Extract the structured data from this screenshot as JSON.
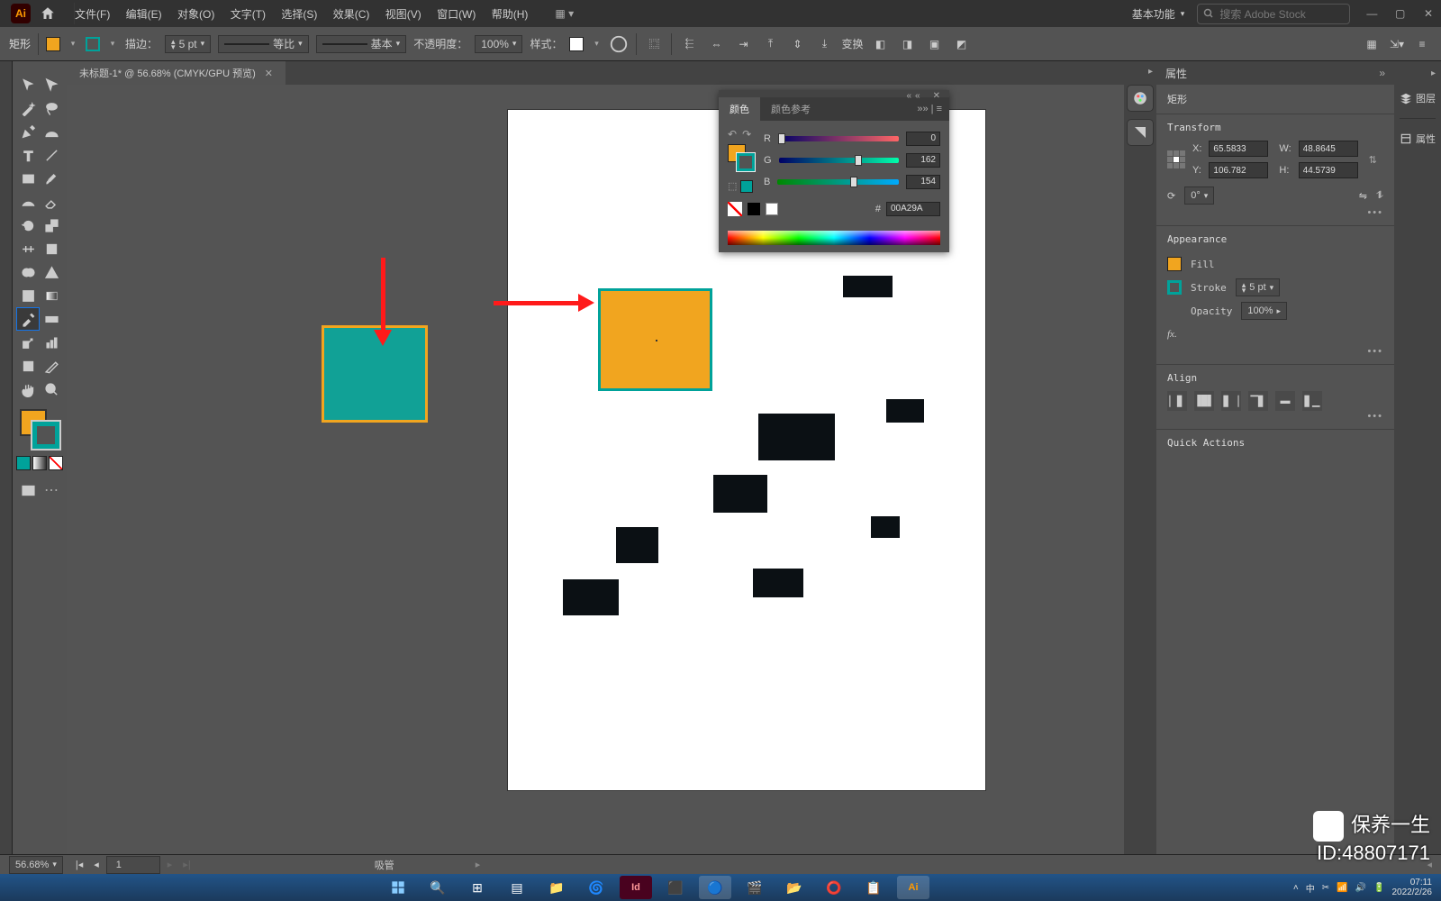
{
  "app": {
    "logo_text": "Ai"
  },
  "menus": {
    "file": "文件(F)",
    "edit": "编辑(E)",
    "object": "对象(O)",
    "type": "文字(T)",
    "select": "选择(S)",
    "effect": "效果(C)",
    "view": "视图(V)",
    "window": "窗口(W)",
    "help": "帮助(H)"
  },
  "workspace": {
    "label": "基本功能"
  },
  "search": {
    "placeholder": "搜索 Adobe Stock"
  },
  "control": {
    "shape_label": "矩形",
    "stroke_label": "描边：",
    "stroke_width": "5 pt",
    "uniform": "等比",
    "basic": "基本",
    "opacity_label": "不透明度：",
    "opacity": "100%",
    "style_label": "样式：",
    "transform": "变换"
  },
  "tab": {
    "title": "未标题-1* @ 56.68% (CMYK/GPU 预览)"
  },
  "color_panel": {
    "tab_color": "颜色",
    "tab_guide": "颜色参考",
    "r_label": "R",
    "g_label": "G",
    "b_label": "B",
    "r": "0",
    "g": "162",
    "b": "154",
    "hex_prefix": "#",
    "hex": "00A29A"
  },
  "properties": {
    "tab": "属性",
    "shape": "矩形",
    "transform": "Transform",
    "x_label": "X:",
    "y_label": "Y:",
    "w_label": "W:",
    "h_label": "H:",
    "x": "65.5833",
    "y": "106.782",
    "w": "48.8645",
    "h": "44.5739",
    "rotate": "0°",
    "appearance": "Appearance",
    "fill": "Fill",
    "stroke": "Stroke",
    "stroke_val": "5 pt",
    "opacity": "Opacity",
    "opacity_val": "100%",
    "fx": "fx.",
    "align": "Align",
    "quick": "Quick Actions"
  },
  "right_dock": {
    "layers": "图层",
    "props": "属性"
  },
  "status": {
    "zoom": "56.68%",
    "page": "1",
    "tool": "吸管"
  },
  "taskbar": {
    "time": "07:11",
    "date": "2022/2/26"
  },
  "watermark": {
    "line1": "保养一生",
    "line2": "ID:48807171"
  },
  "colors": {
    "orange": "#f1a51f",
    "teal": "#00a29a"
  }
}
